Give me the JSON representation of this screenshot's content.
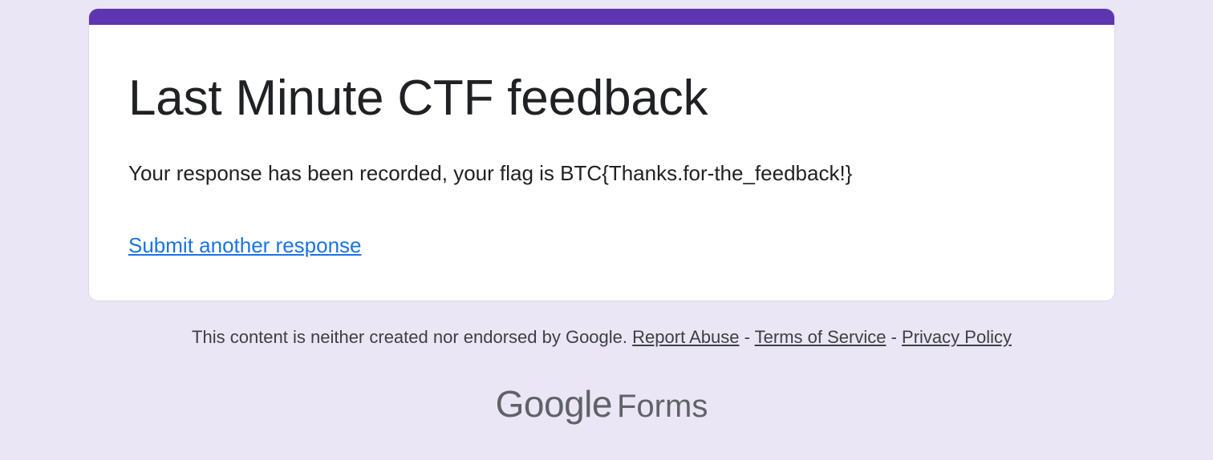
{
  "form": {
    "title": "Last Minute CTF feedback",
    "confirmation_message": "Your response has been recorded, your flag is BTC{Thanks.for-the_feedback!}",
    "submit_another_label": "Submit another response",
    "accent_color": "#5e35b1",
    "background_color": "#ebe6f5"
  },
  "footer": {
    "disclaimer": "This content is neither created nor endorsed by Google.",
    "report_abuse": "Report Abuse",
    "separator": "-",
    "terms": "Terms of Service",
    "privacy": "Privacy Policy"
  },
  "brand": {
    "google": "Google",
    "forms": "Forms"
  }
}
